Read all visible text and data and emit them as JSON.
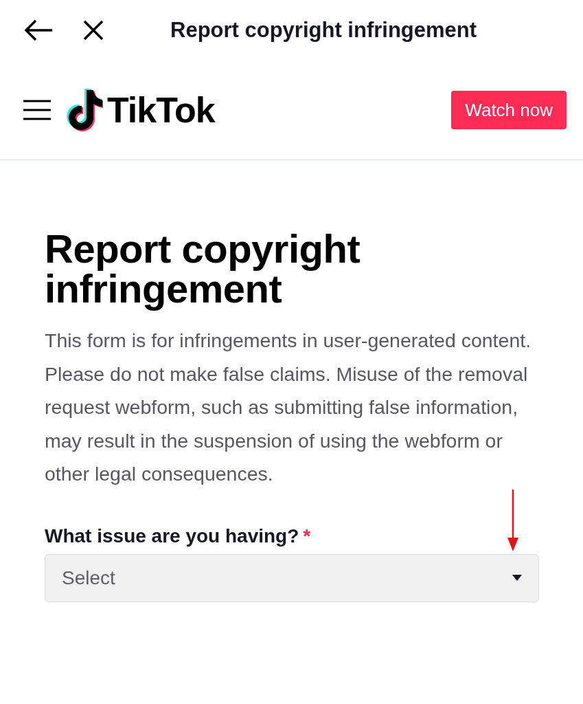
{
  "top_bar": {
    "title": "Report copyright infringement"
  },
  "header": {
    "brand": "TikTok",
    "button": "Watch now"
  },
  "heading": "Report copyright infringement",
  "description": "This form is for infringements in user-generated content. Please do not make false claims. Misuse of the removal request webform, such as submitting false information, may result in the suspension of using the webform or other legal consequences.",
  "field": {
    "label": "What issue are you having?",
    "required": true,
    "required_mark": "*",
    "placeholder": "Select"
  }
}
